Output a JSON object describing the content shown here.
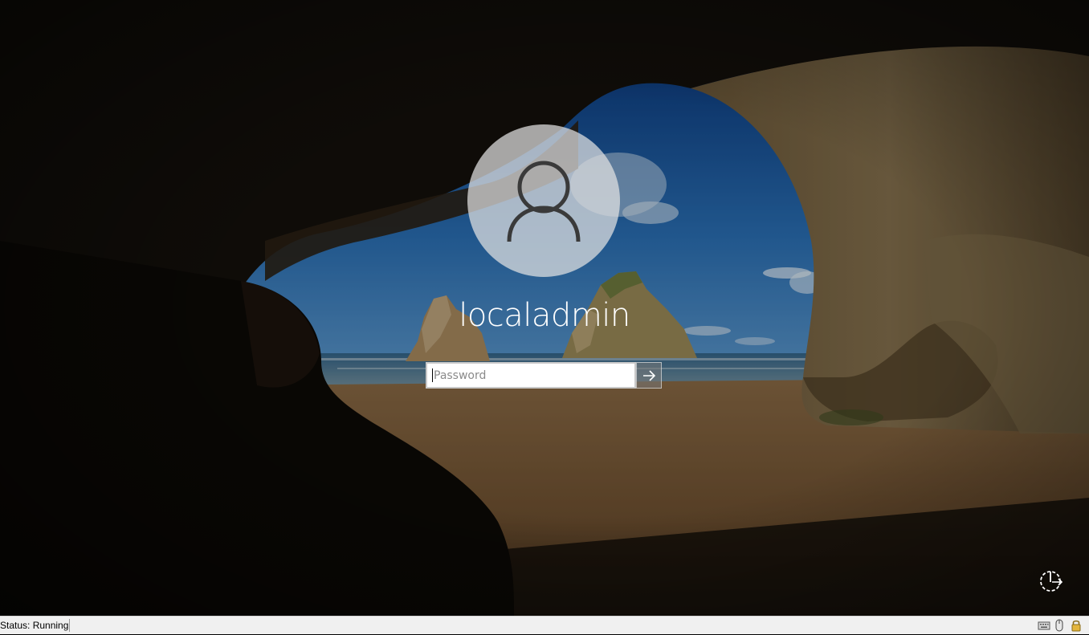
{
  "login": {
    "username": "localadmin",
    "password_placeholder": "Password",
    "password_value": ""
  },
  "icons": {
    "avatar": "user-silhouette-icon",
    "submit": "arrow-right-icon",
    "power": "power-ease-of-access-icon",
    "keyboard": "keyboard-icon",
    "mouse": "mouse-icon",
    "lock": "lock-icon"
  },
  "statusbar": {
    "status": "Status: Running"
  },
  "colors": {
    "text": "#ffffff",
    "avatar_bg": "#e2e2e2",
    "statusbar_bg": "#f0f0f0"
  }
}
